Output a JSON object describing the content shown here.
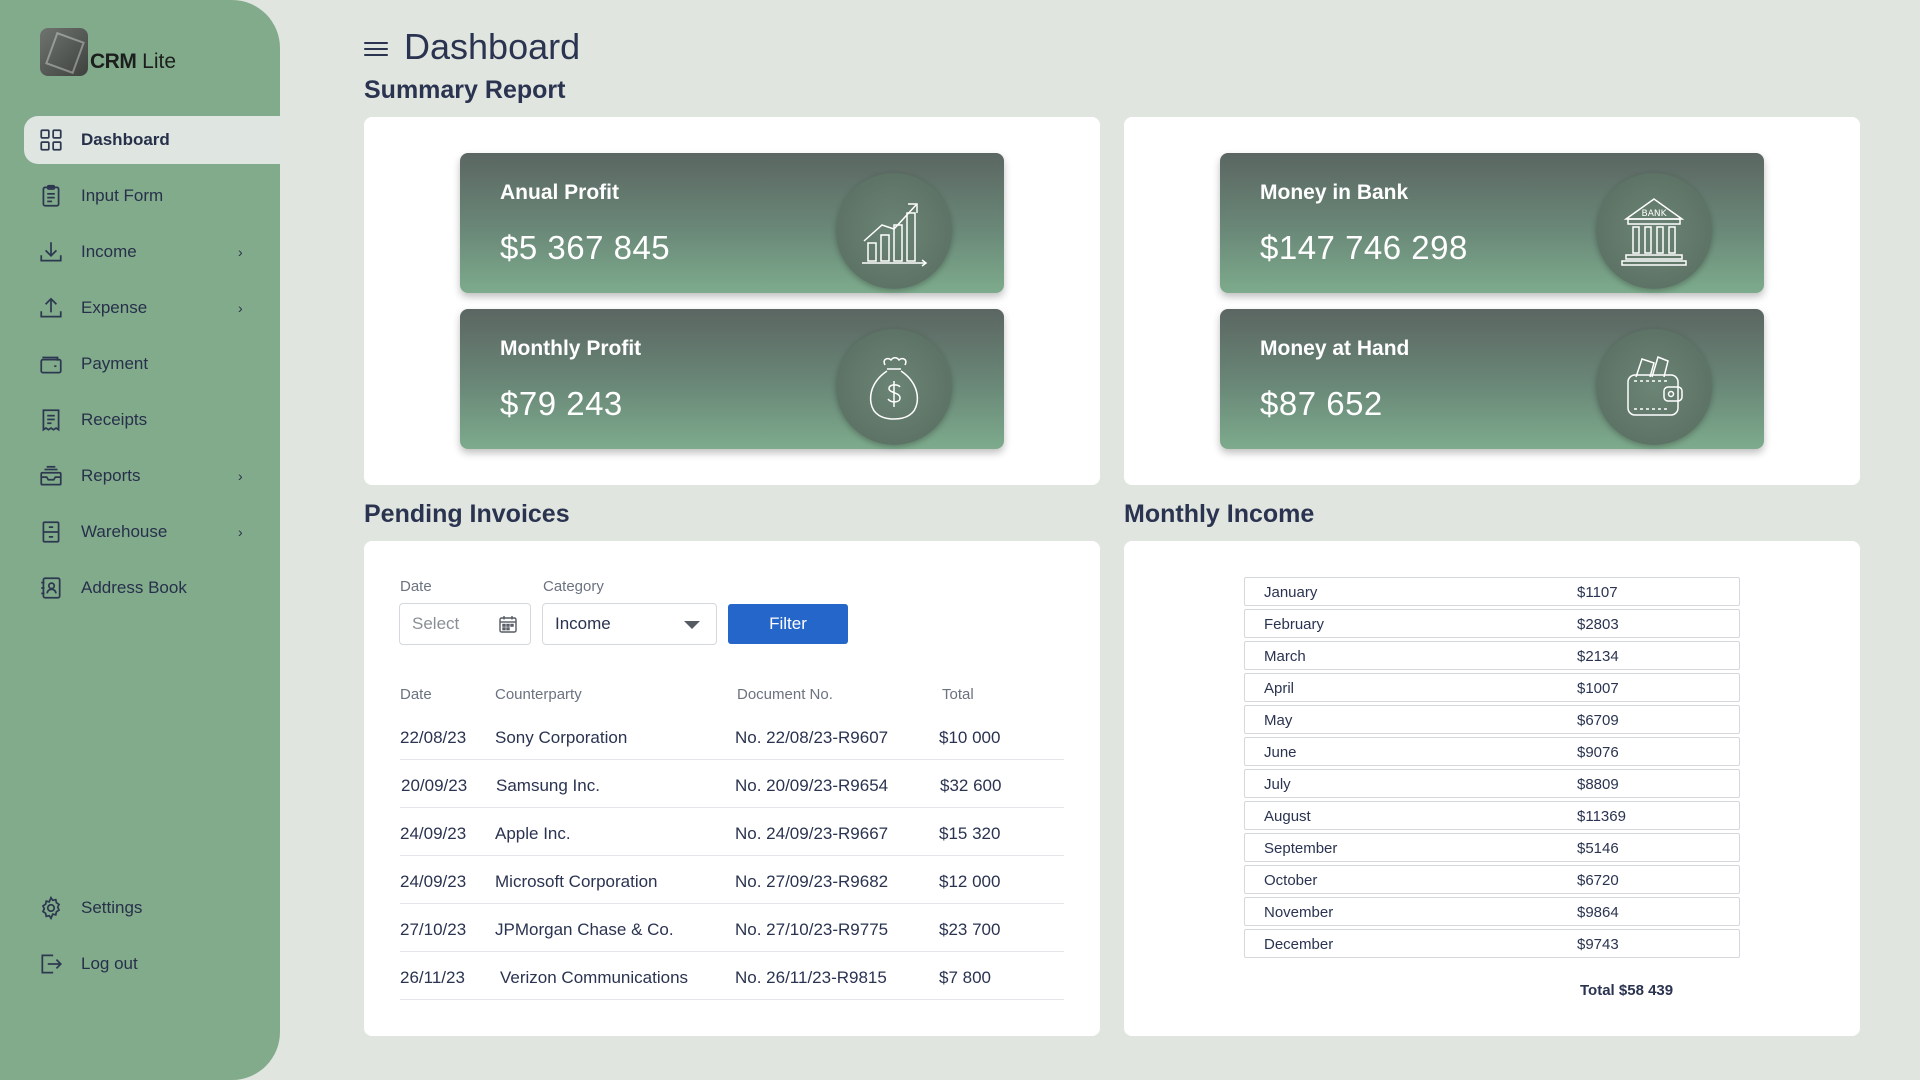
{
  "app": {
    "brand_bold": "CRM",
    "brand_light": "Lite"
  },
  "sidebar": {
    "items": [
      {
        "label": "Dashboard",
        "icon": "grid-icon",
        "active": true
      },
      {
        "label": "Input Form",
        "icon": "clipboard-icon"
      },
      {
        "label": "Income",
        "icon": "download-icon",
        "has_submenu": true
      },
      {
        "label": "Expense",
        "icon": "upload-icon",
        "has_submenu": true
      },
      {
        "label": "Payment",
        "icon": "wallet-icon"
      },
      {
        "label": "Receipts",
        "icon": "receipt-icon"
      },
      {
        "label": "Reports",
        "icon": "inbox-icon",
        "has_submenu": true
      },
      {
        "label": "Warehouse",
        "icon": "cabinet-icon",
        "has_submenu": true
      },
      {
        "label": "Address Book",
        "icon": "contact-book-icon"
      }
    ],
    "bottom": [
      {
        "label": "Settings",
        "icon": "gear-icon"
      },
      {
        "label": "Log out",
        "icon": "logout-icon"
      }
    ]
  },
  "header": {
    "title": "Dashboard"
  },
  "summary": {
    "title": "Summary Report",
    "cards": [
      {
        "title": "Anual Profit",
        "value": "$5 367 845",
        "icon": "chart-growth-icon"
      },
      {
        "title": "Monthly Profit",
        "value": "$79 243",
        "icon": "money-bag-icon"
      },
      {
        "title": "Money in Bank",
        "value": "$147 746 298",
        "icon": "bank-icon",
        "icon_text": "BANK"
      },
      {
        "title": "Money at Hand",
        "value": "$87 652",
        "icon": "wallet-cash-icon"
      }
    ]
  },
  "invoices": {
    "title": "Pending Invoices",
    "filters": {
      "date_label": "Date",
      "date_placeholder": "Select",
      "category_label": "Category",
      "category_value": "Income",
      "filter_button": "Filter"
    },
    "columns": [
      "Date",
      "Counterparty",
      "Document No.",
      "Total"
    ],
    "rows": [
      [
        "22/08/23",
        "Sony Corporation",
        "No. 22/08/23-R9607",
        "$10 000"
      ],
      [
        "20/09/23",
        "Samsung Inc.",
        "No. 20/09/23-R9654",
        "$32 600"
      ],
      [
        "24/09/23",
        "Apple Inc.",
        "No. 24/09/23-R9667",
        "$15 320"
      ],
      [
        "24/09/23",
        "Microsoft Corporation",
        "No. 27/09/23-R9682",
        "$12 000"
      ],
      [
        "27/10/23",
        "JPMorgan Chase & Co.",
        "No. 27/10/23-R9775",
        "$23 700"
      ],
      [
        "26/11/23",
        "Verizon Communications",
        "No. 26/11/23-R9815",
        "$7 800"
      ]
    ]
  },
  "monthly_income": {
    "title": "Monthly Income",
    "rows": [
      [
        "January",
        "$1107"
      ],
      [
        "February",
        "$2803"
      ],
      [
        "March",
        "$2134"
      ],
      [
        "April",
        "$1007"
      ],
      [
        "May",
        "$6709"
      ],
      [
        "June",
        "$9076"
      ],
      [
        "July",
        "$8809"
      ],
      [
        "August",
        "$11369"
      ],
      [
        "September",
        "$5146"
      ],
      [
        "October",
        "$6720"
      ],
      [
        "November",
        "$9864"
      ],
      [
        "December",
        "$9743"
      ]
    ],
    "total": "Total $58 439"
  },
  "colors": {
    "sidebar_bg": "#82ab8c",
    "page_bg": "#e0e5df",
    "accent_button": "#2466c9",
    "text_primary": "#2a3350"
  }
}
